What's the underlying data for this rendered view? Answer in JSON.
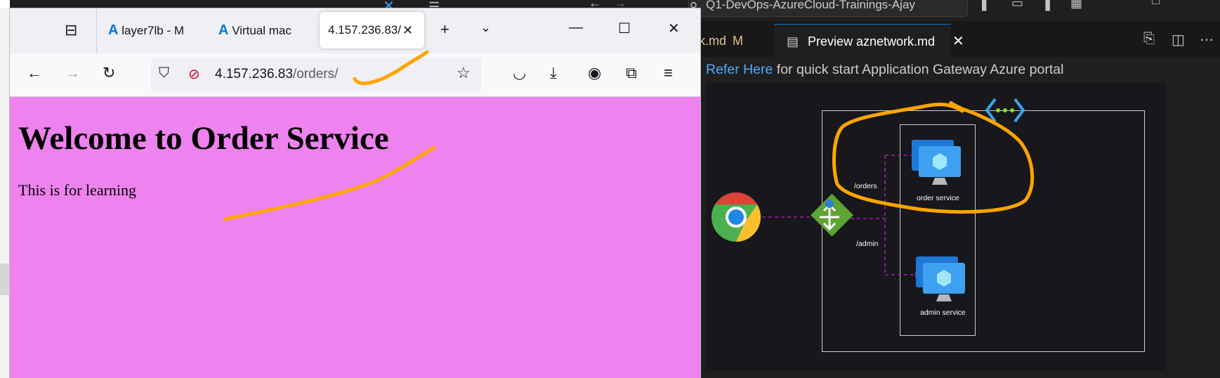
{
  "browser": {
    "tabs": [
      {
        "title": "layer7lb - M"
      },
      {
        "title": "Virtual mac"
      },
      {
        "title": "4.157.236.83/",
        "active": true
      }
    ],
    "url": {
      "host": "4.157.236.83",
      "path": "/orders/"
    },
    "page": {
      "heading": "Welcome to Order Service",
      "text": "This is for learning",
      "background": "#ee82ee"
    }
  },
  "vscode": {
    "search": "Q1-DevOps-AzureCloud-Trainings-Ajay",
    "tabs": [
      {
        "title": "k.md",
        "badge": "M"
      },
      {
        "title": "Preview aznetwork.md",
        "active": true
      }
    ],
    "preview": {
      "link": "Refer Here",
      "line_rest": "for quick start Application Gateway Azure portal"
    },
    "diagram": {
      "labels": {
        "orders_path": "/orders",
        "admin_path": "/admin",
        "order_service": "order service",
        "admin_service": "admin service"
      }
    }
  },
  "annotation_color": "#ffa500"
}
